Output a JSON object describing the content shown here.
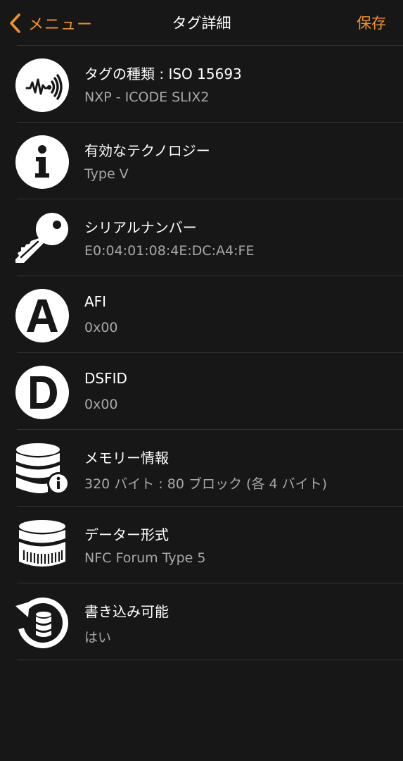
{
  "nav": {
    "back_label": "メニュー",
    "title": "タグ詳細",
    "save_label": "保存",
    "accent_color": "#f0922b"
  },
  "rows": [
    {
      "icon": "nfc-tag-icon",
      "label": "タグの種類 : ISO 15693",
      "value": "NXP - ICODE SLIX2"
    },
    {
      "icon": "info-icon",
      "label": "有効なテクノロジー",
      "value": "Type V"
    },
    {
      "icon": "key-icon",
      "label": "シリアルナンバー",
      "value": "E0:04:01:08:4E:DC:A4:FE"
    },
    {
      "icon": "letter-a-icon",
      "label": "AFI",
      "value": "0x00"
    },
    {
      "icon": "letter-d-icon",
      "label": "DSFID",
      "value": "0x00"
    },
    {
      "icon": "database-info-icon",
      "label": "メモリー情報",
      "value": "320 バイト : 80 ブロック (各 4 バイト)"
    },
    {
      "icon": "database-icon",
      "label": "データー形式",
      "value": "NFC Forum Type 5"
    },
    {
      "icon": "database-refresh-icon",
      "label": "書き込み可能",
      "value": "はい"
    }
  ]
}
